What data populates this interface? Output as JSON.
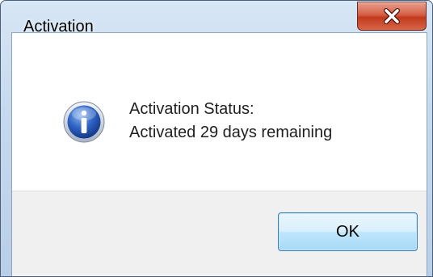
{
  "window": {
    "title": "Activation"
  },
  "title_bar": {
    "close_icon": "close-x-icon",
    "close_color": "#c7432a"
  },
  "message": {
    "icon": "information-icon",
    "line1": "Activation Status:",
    "line2": "Activated 29 days remaining"
  },
  "buttons": {
    "ok_label": "OK"
  }
}
